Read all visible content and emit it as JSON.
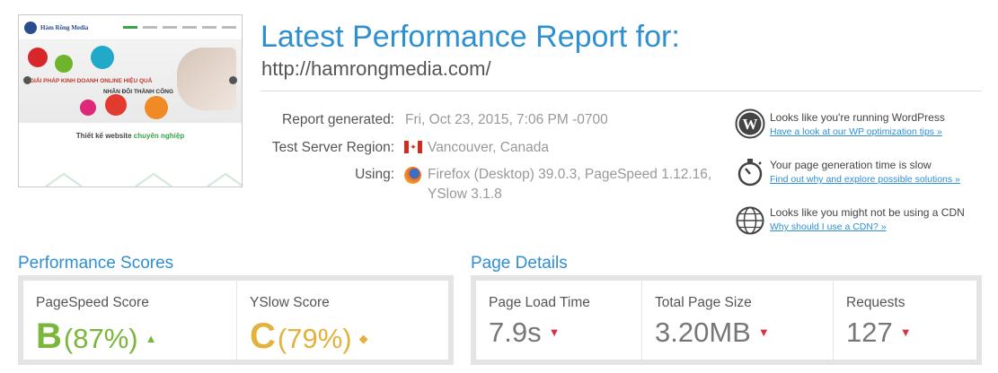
{
  "thumbnail": {
    "brand": "Hàm Rồng Media",
    "hero_line1": "GIẢI PHÁP KINH DOANH ONLINE HIỆU QUẢ",
    "hero_line2": "NHÂN ĐÔI THÀNH CÔNG",
    "subtitle_prefix": "Thiết kế website",
    "subtitle_highlight": "chuyên nghiệp"
  },
  "header": {
    "title": "Latest Performance Report for:",
    "url": "http://hamrongmedia.com/"
  },
  "meta": {
    "report_generated_label": "Report generated:",
    "report_generated_value": "Fri, Oct 23, 2015, 7:06 PM -0700",
    "region_label": "Test Server Region:",
    "region_value": "Vancouver, Canada",
    "using_label": "Using:",
    "using_value_line1": "Firefox (Desktop) 39.0.3, PageSpeed 1.12.16,",
    "using_value_line2": "YSlow 3.1.8"
  },
  "tips": [
    {
      "icon": "wordpress-icon",
      "text": "Looks like you're running WordPress",
      "link": "Have a look at our WP optimization tips »"
    },
    {
      "icon": "stopwatch-icon",
      "text": "Your page generation time is slow",
      "link": "Find out why and explore possible solutions »"
    },
    {
      "icon": "globe-icon",
      "text": "Looks like you might not be using a CDN",
      "link": "Why should I use a CDN? »"
    }
  ],
  "performance": {
    "title": "Performance Scores",
    "pagespeed": {
      "label": "PageSpeed Score",
      "grade": "B",
      "percent": "(87%)",
      "trend": "▲"
    },
    "yslow": {
      "label": "YSlow Score",
      "grade": "C",
      "percent": "(79%)",
      "trend": "◆"
    }
  },
  "details": {
    "title": "Page Details",
    "load_time": {
      "label": "Page Load Time",
      "value": "7.9s",
      "trend": "▼"
    },
    "page_size": {
      "label": "Total Page Size",
      "value": "3.20MB",
      "trend": "▼"
    },
    "requests": {
      "label": "Requests",
      "value": "127",
      "trend": "▼"
    }
  },
  "colors": {
    "accent": "#2e8fd1",
    "grade_b": "#79b63a",
    "grade_c": "#e2b23a",
    "trend_down": "#d4334a"
  }
}
